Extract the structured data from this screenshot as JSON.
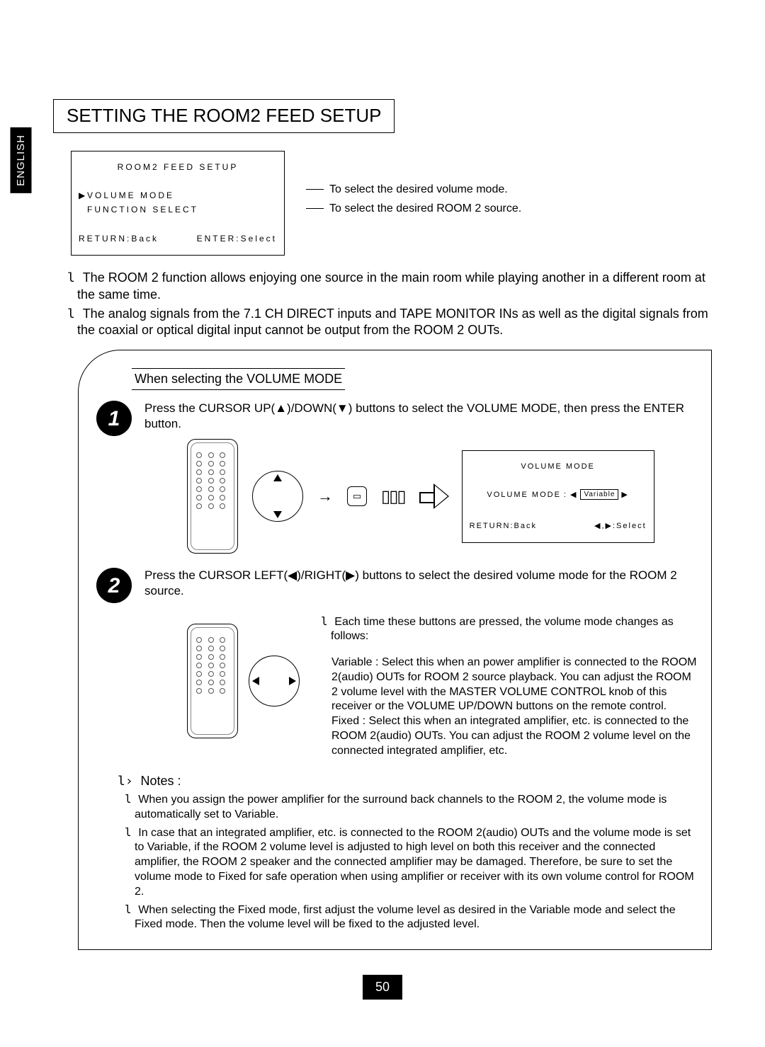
{
  "language_tab": "ENGLISH",
  "title": "SETTING THE ROOM2 FEED SETUP",
  "osd": {
    "title": "ROOM2 FEED SETUP",
    "item1": "VOLUME MODE",
    "item2": "FUNCTION SELECT",
    "footer_left": "RETURN:Back",
    "footer_right": "ENTER:Select",
    "label1": "To select the desired volume mode.",
    "label2": "To select the desired ROOM 2 source."
  },
  "intro_bullets": [
    "The ROOM 2 function allows enjoying one source in the main room while playing another in a different room at the same time.",
    "The analog signals from the 7.1 CH DIRECT inputs and TAPE MONITOR INs as well as the digital signals from the coaxial or optical digital input cannot be output from the ROOM 2 OUTs."
  ],
  "section_header": "When selecting the VOLUME MODE",
  "step1": {
    "num": "1",
    "text": "Press the CURSOR UP(▲)/DOWN(▼) buttons to select the VOLUME MODE, then press the ENTER button.",
    "osd": {
      "title": "VOLUME MODE",
      "row_label": "VOLUME MODE",
      "row_sep": ":",
      "row_value": "Variable",
      "footer_left": "RETURN:Back",
      "footer_right": "◀,▶:Select"
    }
  },
  "step2": {
    "num": "2",
    "text": "Press the CURSOR LEFT(◀)/RIGHT(▶) buttons to select the desired volume mode for the ROOM 2 source.",
    "sub_intro": "Each time these buttons are pressed, the volume mode changes as follows:",
    "mode_variable": "Variable : Select this when an power amplifier is connected to the ROOM 2(audio) OUTs for ROOM 2 source playback. You can adjust the ROOM 2 volume level with the MASTER VOLUME CONTROL knob of this receiver or the VOLUME UP/DOWN buttons on the remote control.",
    "mode_fixed": "Fixed : Select this when an integrated amplifier, etc. is connected to the ROOM 2(audio) OUTs. You can adjust the ROOM 2 volume level on the connected integrated amplifier, etc."
  },
  "notes_header": "Notes :",
  "notes": [
    "When you assign the power amplifier for the surround back channels to the ROOM 2, the volume mode is automatically set to Variable.",
    "In case that an integrated amplifier, etc. is connected to the ROOM 2(audio) OUTs and the volume mode is set to Variable, if the ROOM 2 volume level is adjusted to high level on both this receiver and the connected amplifier, the ROOM 2 speaker and the connected amplifier may be damaged. Therefore, be sure to set the volume mode to Fixed for safe operation when using amplifier or receiver with its own volume control for ROOM 2.",
    "When selecting the Fixed mode, first adjust the volume level as desired in the Variable mode and select the Fixed mode. Then the volume level will be fixed to the adjusted level."
  ],
  "page_number": "50"
}
